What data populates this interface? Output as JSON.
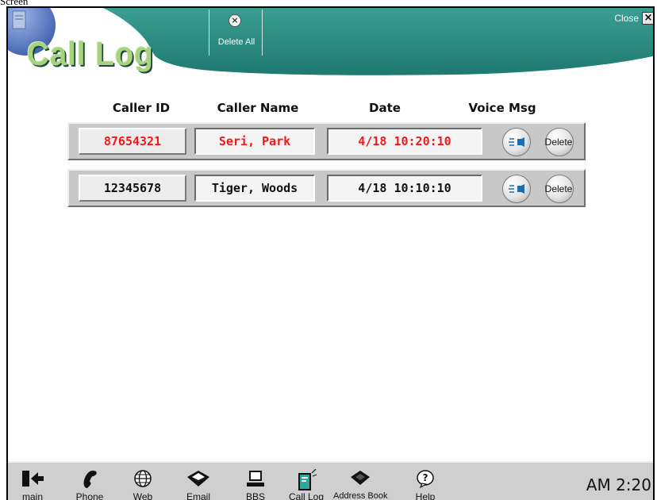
{
  "page_caption": "Screen",
  "app": {
    "title": "Call Log"
  },
  "toolbar": {
    "delete_all_label": "Delete All",
    "close_label": "Close"
  },
  "columns": {
    "caller_id": "Caller ID",
    "caller_name": "Caller Name",
    "date": "Date",
    "voice_msg": "Voice Msg"
  },
  "calls": [
    {
      "caller_id": "87654321",
      "caller_name": "Seri, Park",
      "date": "4/18 10:20:10",
      "delete_label": "Delete",
      "text_color": "#f01818"
    },
    {
      "caller_id": "12345678",
      "caller_name": "Tiger, Woods",
      "date": "4/18 10:10:10",
      "delete_label": "Delete",
      "text_color": "#111111"
    }
  ],
  "taskbar": {
    "items": [
      {
        "label": "main",
        "icon": "back-arrow-icon"
      },
      {
        "label": "Phone",
        "icon": "phone-icon"
      },
      {
        "label": "Web",
        "icon": "globe-icon"
      },
      {
        "label": "Email",
        "icon": "envelope-icon"
      },
      {
        "label": "BBS",
        "icon": "computer-icon"
      },
      {
        "label": "Call Log",
        "icon": "call-log-icon"
      },
      {
        "label": "Address Book",
        "icon": "address-book-icon"
      },
      {
        "label": "Help",
        "icon": "help-icon"
      }
    ],
    "clock": "AM 2:20"
  },
  "colors": {
    "header_teal": "#2a8d82",
    "title_green": "#a7d27e",
    "missed_call_red": "#f01818",
    "panel_gray": "#c8c8c8",
    "taskbar_gray": "#cfcfcf"
  }
}
